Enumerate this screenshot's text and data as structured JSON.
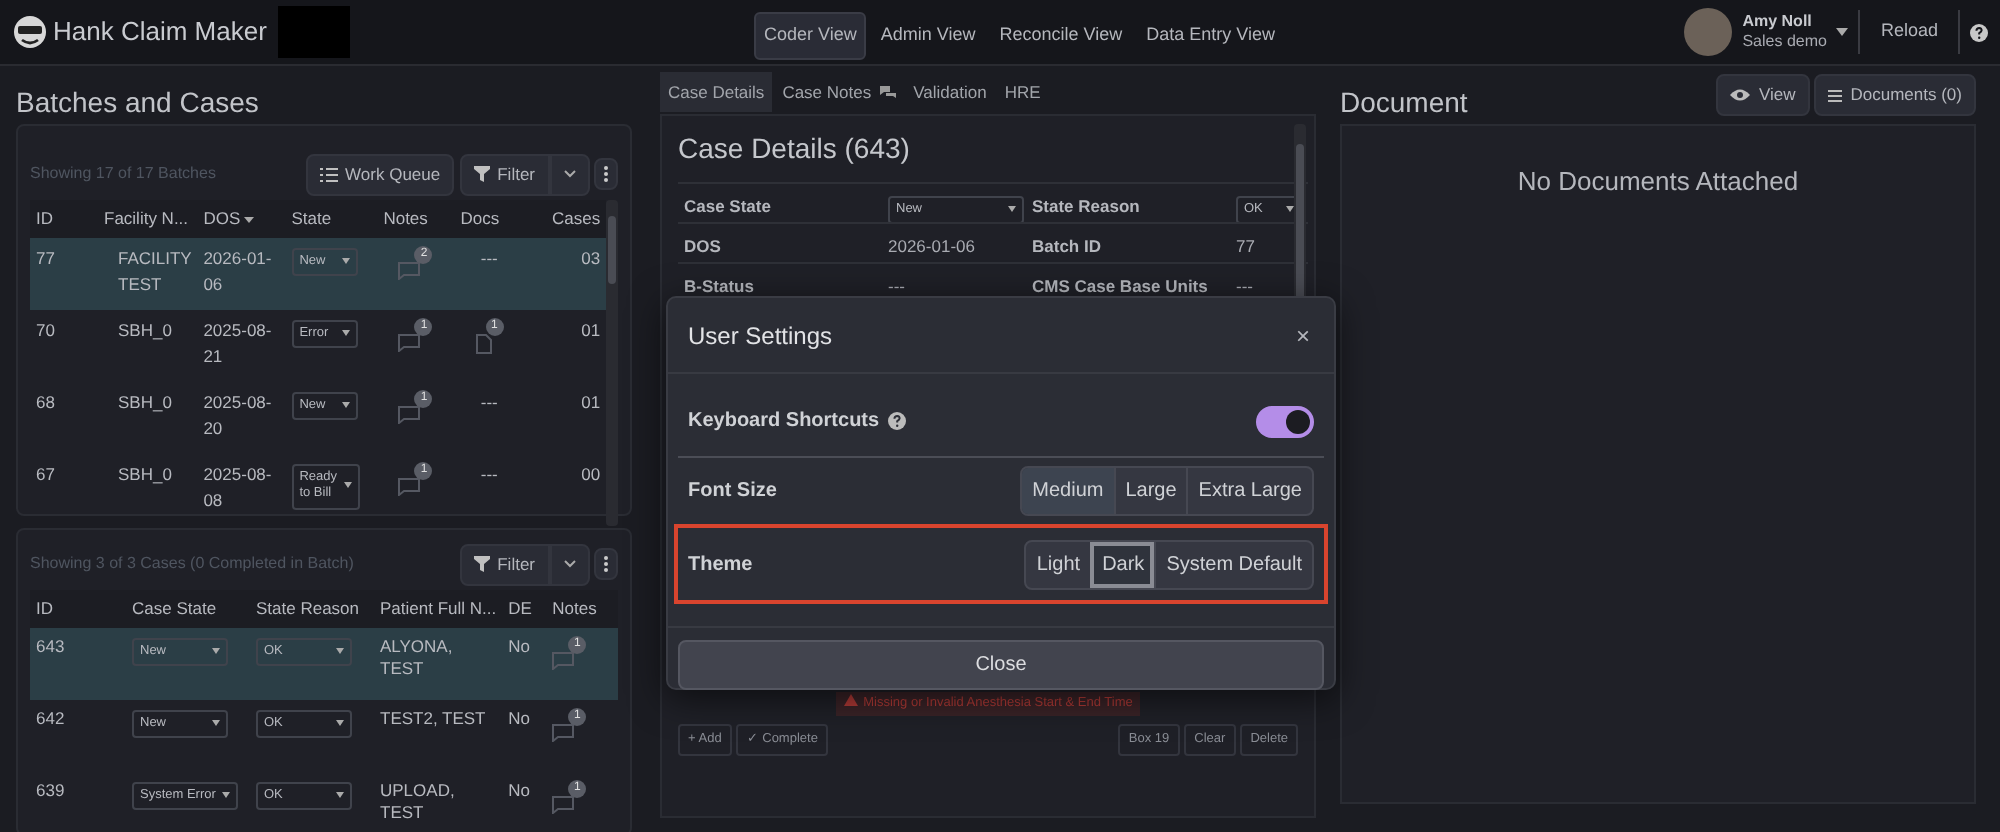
{
  "navbar": {
    "title": "Hank Claim Maker",
    "views": [
      {
        "label": "Coder View",
        "selected": true
      },
      {
        "label": "Admin View",
        "selected": false
      },
      {
        "label": "Reconcile View",
        "selected": false
      },
      {
        "label": "Data Entry View",
        "selected": false
      }
    ],
    "user": {
      "name": "Amy Noll",
      "role": "Sales demo"
    },
    "reload": "Reload"
  },
  "left": {
    "heading": "Batches and Cases",
    "batches": {
      "summary": "Showing 17 of 17 Batches",
      "work_queue": "Work Queue",
      "filter": "Filter",
      "columns": [
        "ID",
        "Facility N...",
        "DOS",
        "State",
        "Notes",
        "Docs",
        "Cases"
      ],
      "rows": [
        {
          "id": "77",
          "facility": "FACILITY TEST",
          "dos": "2026-01-06",
          "state": "New",
          "notes": "2",
          "docs": {
            "kind": "text",
            "text": "---"
          },
          "cases": "03",
          "selected": true
        },
        {
          "id": "70",
          "facility": "SBH_0",
          "dos": "2025-08-21",
          "state": "Error",
          "notes": "1",
          "docs": {
            "kind": "badge",
            "text": "1"
          },
          "cases": "01",
          "selected": false
        },
        {
          "id": "68",
          "facility": "SBH_0",
          "dos": "2025-08-20",
          "state": "New",
          "notes": "1",
          "docs": {
            "kind": "text",
            "text": "---"
          },
          "cases": "01",
          "selected": false
        },
        {
          "id": "67",
          "facility": "SBH_0",
          "dos": "2025-08-08",
          "state": "Ready to Bill",
          "notes": "1",
          "docs": {
            "kind": "text",
            "text": "---"
          },
          "cases": "00",
          "selected": false
        }
      ]
    },
    "cases": {
      "summary": "Showing 3 of 3 Cases (0 Completed in Batch)",
      "filter": "Filter",
      "columns": [
        "ID",
        "Case State",
        "State Reason",
        "Patient Full N...",
        "DE",
        "Notes"
      ],
      "rows": [
        {
          "id": "643",
          "state": "New",
          "reason": "OK",
          "patient": "ALYONA, TEST",
          "de": "No",
          "notes": "1",
          "selected": true
        },
        {
          "id": "642",
          "state": "New",
          "reason": "OK",
          "patient": "TEST2, TEST",
          "de": "No",
          "notes": "1",
          "selected": false
        },
        {
          "id": "639",
          "state": "System Error",
          "reason": "OK",
          "patient": "UPLOAD, TEST",
          "de": "No",
          "notes": "1",
          "selected": false
        }
      ]
    }
  },
  "middle": {
    "tabs": [
      {
        "label": "Case Details",
        "selected": true,
        "icon": false
      },
      {
        "label": "Case Notes",
        "selected": false,
        "icon": true
      },
      {
        "label": "Validation",
        "selected": false,
        "icon": false
      },
      {
        "label": "HRE",
        "selected": false,
        "icon": false
      }
    ],
    "title": "Case Details (643)",
    "fields": [
      {
        "label": "Case State",
        "value": "New",
        "kind": "select"
      },
      {
        "label": "State Reason",
        "value": "OK",
        "kind": "select"
      },
      {
        "label": "DOS",
        "value": "2026-01-06",
        "kind": "text"
      },
      {
        "label": "Batch ID",
        "value": "77",
        "kind": "text"
      },
      {
        "label": "B-Status",
        "value": "---",
        "kind": "text"
      },
      {
        "label": "CMS Case Base Units",
        "value": "---",
        "kind": "text"
      }
    ],
    "warning": "Missing or Invalid Anesthesia Start & End Time",
    "actions_left": [
      "+ Add",
      "✓ Complete"
    ],
    "actions_right": [
      "Box 19",
      "Clear",
      "Delete"
    ]
  },
  "right": {
    "heading": "Document",
    "view": "View",
    "documents": "Documents (0)",
    "empty": "No Documents Attached"
  },
  "modal": {
    "title": "User Settings",
    "close_x": "×",
    "settings": [
      {
        "label": "Keyboard Shortcuts",
        "kind": "toggle",
        "help": true,
        "on": true,
        "highlighted": false
      },
      {
        "label": "Font Size",
        "kind": "choice",
        "highlighted": false,
        "options": [
          {
            "label": "Medium",
            "selected": true
          },
          {
            "label": "Large",
            "selected": false
          },
          {
            "label": "Extra Large",
            "selected": false
          }
        ]
      },
      {
        "label": "Theme",
        "kind": "choice",
        "highlighted": true,
        "options": [
          {
            "label": "Light",
            "selected": false
          },
          {
            "label": "Dark",
            "selected": true
          },
          {
            "label": "System Default",
            "selected": false
          }
        ]
      }
    ],
    "close": "Close"
  }
}
